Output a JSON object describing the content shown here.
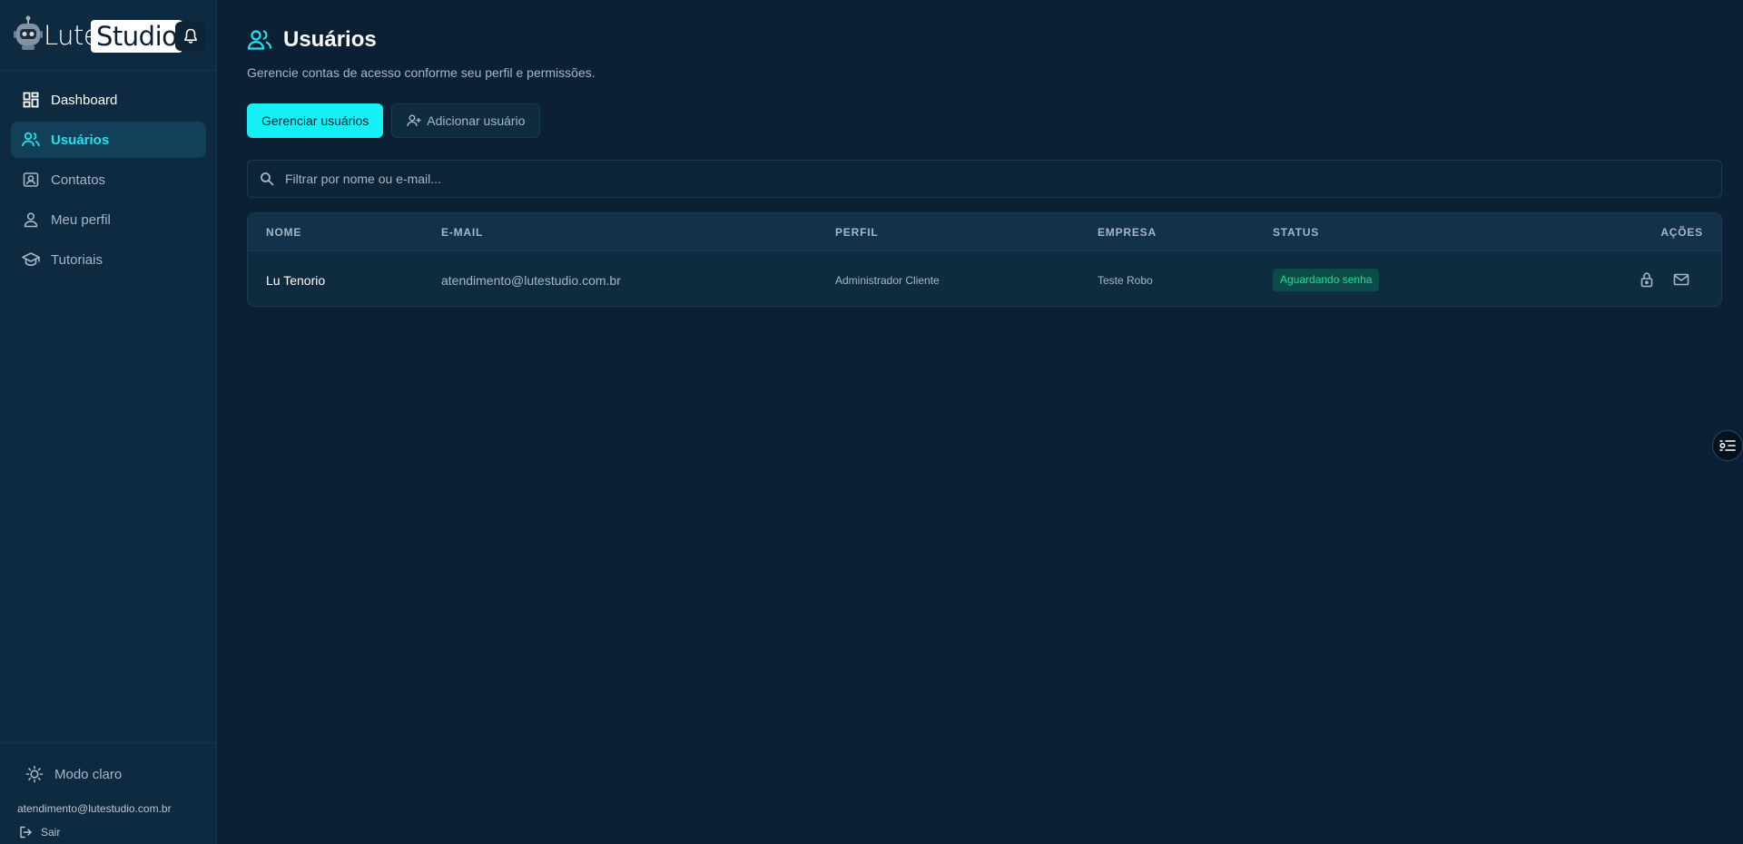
{
  "brand": {
    "name_part1": "Lute",
    "name_part2": "Studio"
  },
  "sidebar": {
    "items": [
      {
        "label": "Dashboard",
        "icon": "dashboard-icon"
      },
      {
        "label": "Usuários",
        "icon": "users-icon",
        "active": true
      },
      {
        "label": "Contatos",
        "icon": "contacts-icon"
      },
      {
        "label": "Meu perfil",
        "icon": "profile-icon"
      },
      {
        "label": "Tutoriais",
        "icon": "graduation-cap-icon"
      }
    ],
    "mode_label": "Modo claro",
    "user_email": "atendimento@lutestudio.com.br",
    "logout_label": "Sair"
  },
  "page": {
    "title": "Usuários",
    "subtitle": "Gerencie contas de acesso conforme seu perfil e permissões."
  },
  "tabs": {
    "manage": "Gerenciar usuários",
    "add": "Adicionar usuário"
  },
  "search": {
    "placeholder": "Filtrar por nome ou e-mail..."
  },
  "table": {
    "columns": [
      "NOME",
      "E-MAIL",
      "PERFIL",
      "EMPRESA",
      "STATUS",
      "AÇÕES"
    ],
    "rows": [
      {
        "name": "Lu Tenorio",
        "email": "atendimento@lutestudio.com.br",
        "profile": "Administrador Cliente",
        "company": "Teste Robo",
        "status": "Aguardando senha"
      }
    ]
  },
  "colors": {
    "accent": "#14f0f6",
    "background": "#0b2035",
    "sidebar": "#0e2a40",
    "status_text": "#19e08a"
  }
}
